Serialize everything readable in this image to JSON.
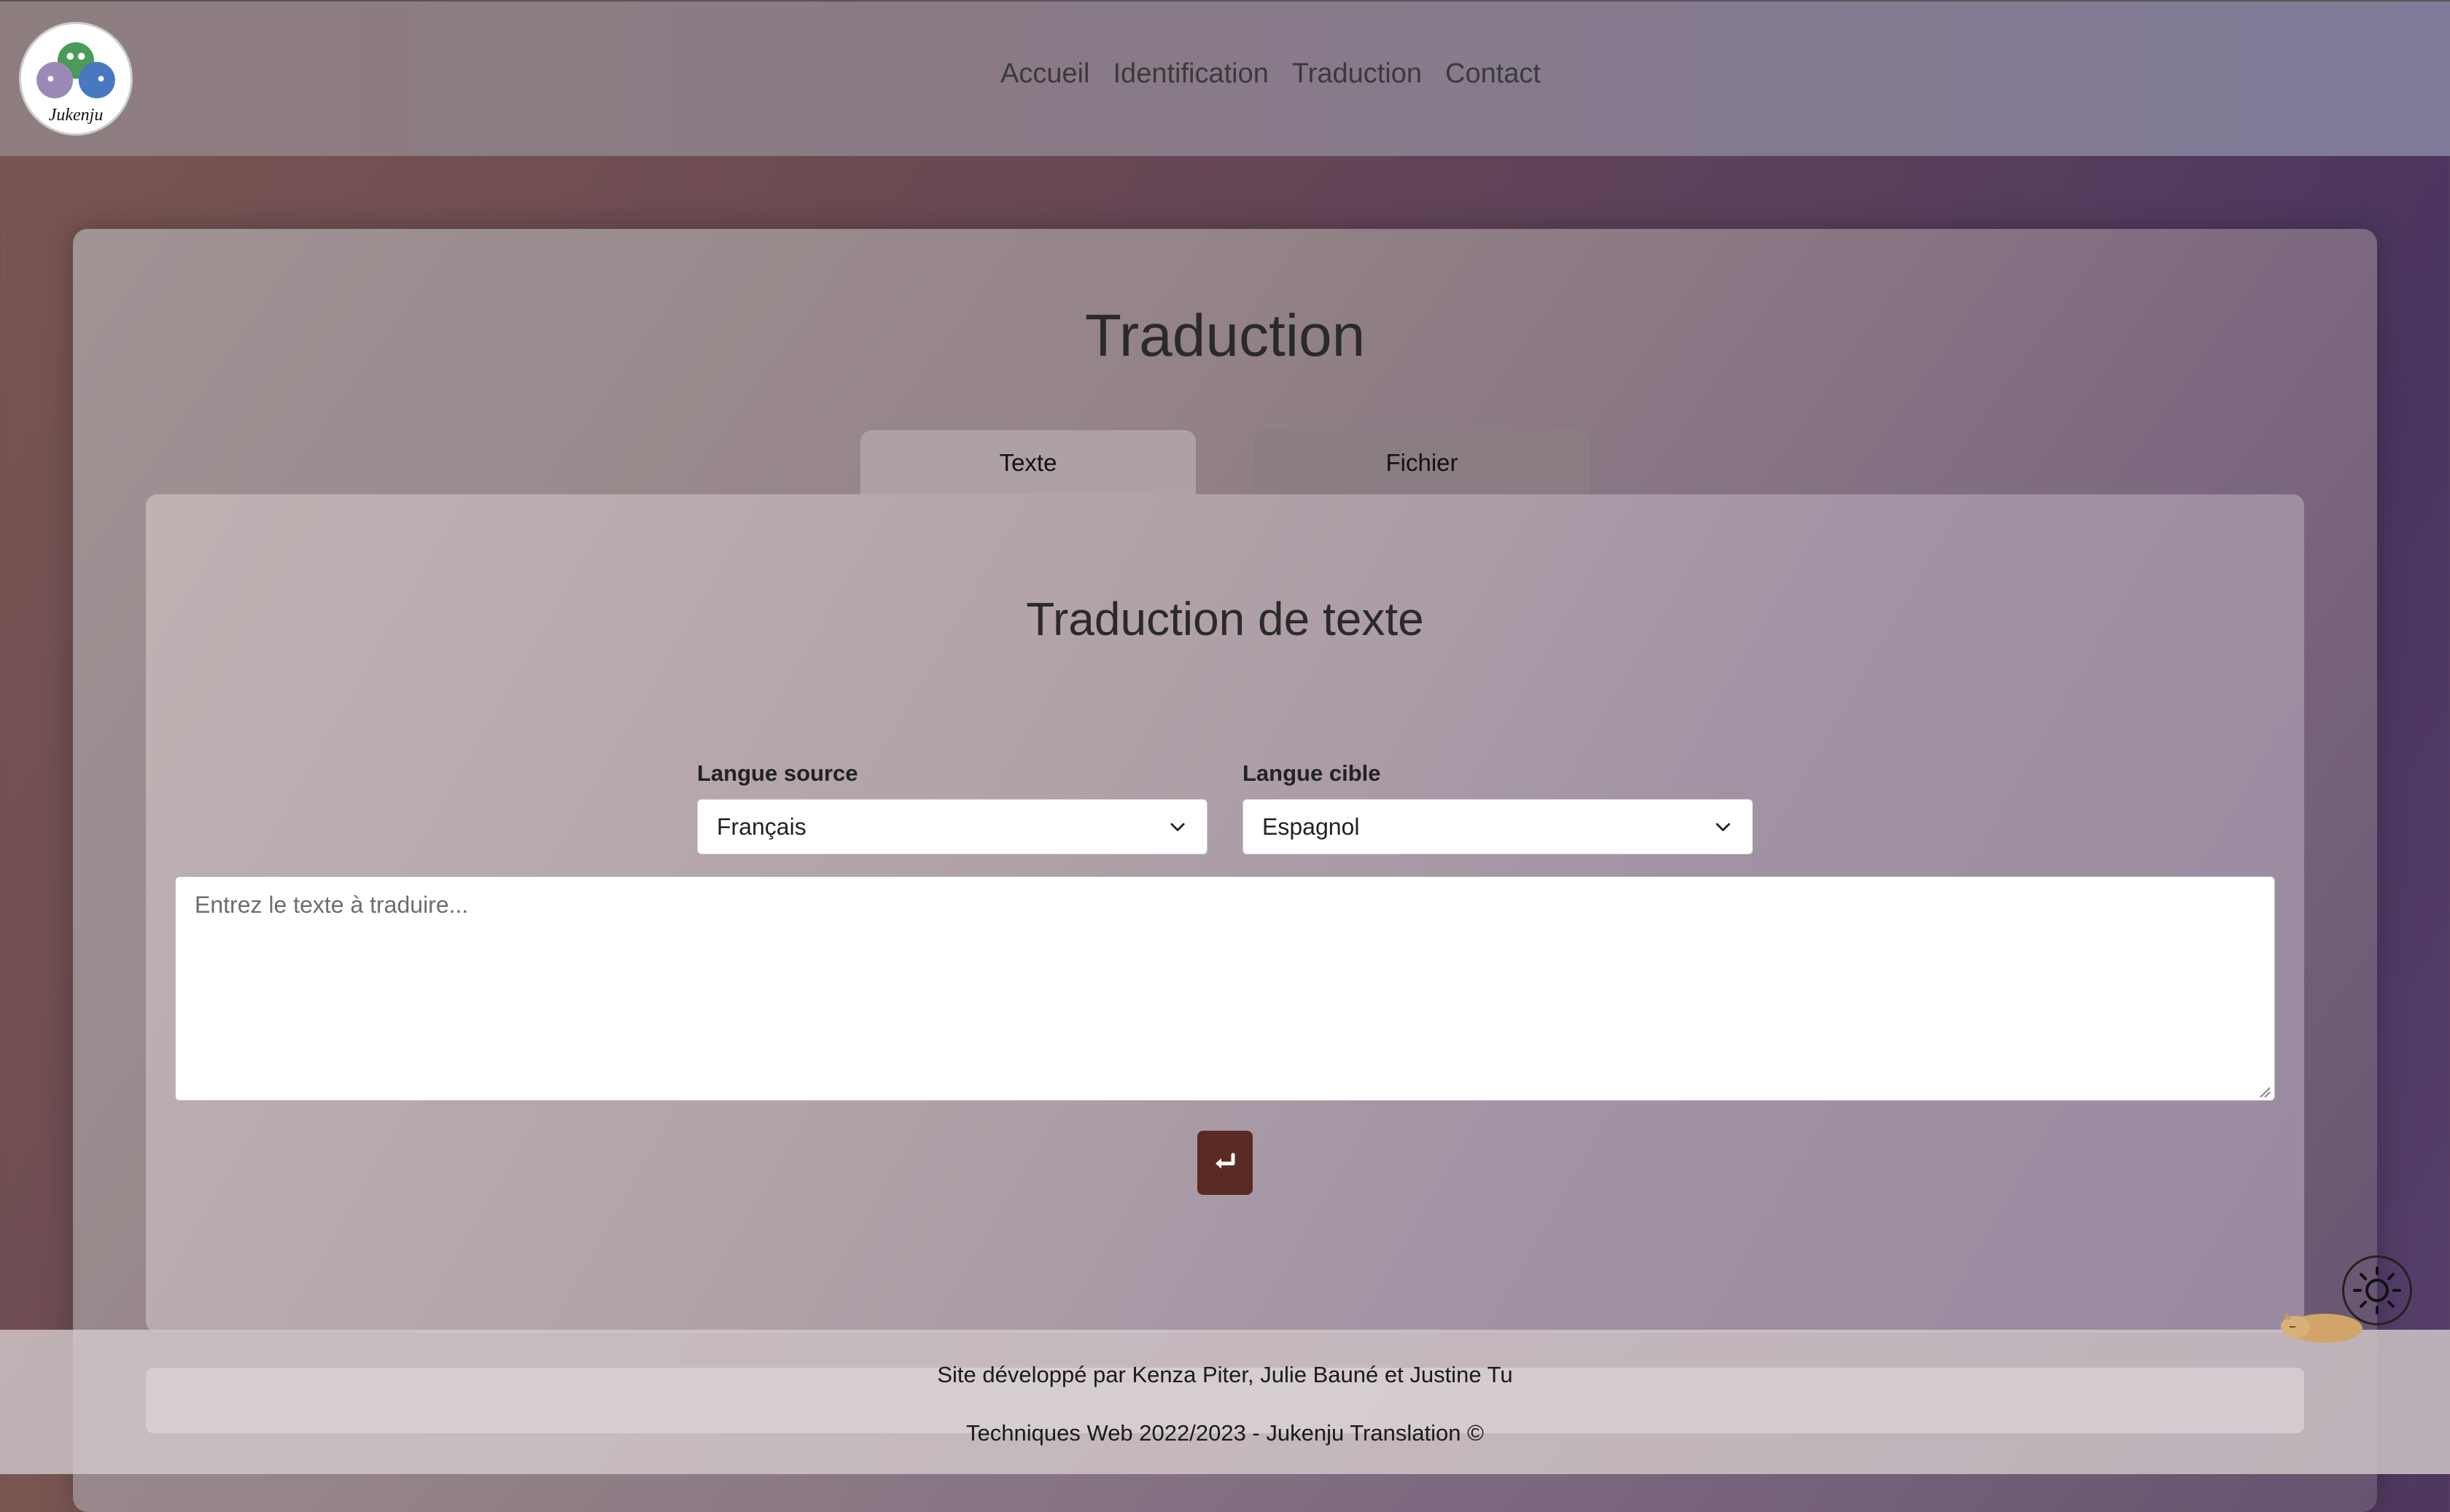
{
  "header": {
    "logo_text": "Jukenju",
    "nav": [
      "Accueil",
      "Identification",
      "Traduction",
      "Contact"
    ]
  },
  "main": {
    "title": "Traduction",
    "tabs": [
      {
        "label": "Texte",
        "active": true
      },
      {
        "label": "Fichier",
        "active": false
      }
    ],
    "card_title": "Traduction de texte",
    "source": {
      "label": "Langue source",
      "value": "Français"
    },
    "target": {
      "label": "Langue cible",
      "value": "Espagnol"
    },
    "textarea_placeholder": "Entrez le texte à traduire...",
    "submit_icon": "enter-return-icon"
  },
  "footer": {
    "line1": "Site développé par Kenza Piter, Julie Bauné et Justine Tu",
    "line2": "Techniques Web 2022/2023 - Jukenju Translation ©"
  },
  "colors": {
    "submit_button": "#5a2a24",
    "active_tab": "#aea1a6",
    "inactive_tab": "#8a7d84"
  }
}
